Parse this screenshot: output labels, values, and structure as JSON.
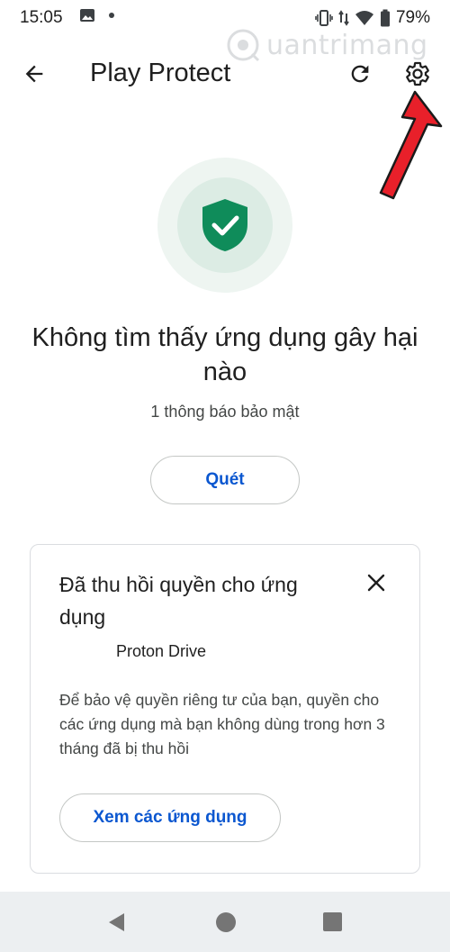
{
  "status_bar": {
    "time": "15:05",
    "battery": "79%",
    "icons": [
      "image-icon",
      "dot-icon",
      "vibrate-icon",
      "data-icon",
      "wifi-icon",
      "battery-icon"
    ]
  },
  "app_bar": {
    "title": "Play Protect",
    "back_icon": "arrow-back-icon",
    "refresh_icon": "refresh-icon",
    "settings_icon": "gear-icon"
  },
  "watermark": {
    "text": "uantrimang"
  },
  "status": {
    "headline": "Không tìm thấy ứng dụng gây hại nào",
    "subline": "1 thông báo bảo mật",
    "shield_icon": "shield-check-icon"
  },
  "scan_button": {
    "label": "Quét"
  },
  "card": {
    "title": "Đã thu hồi quyền cho ứng dụng",
    "app_name": "Proton Drive",
    "body": "Để bảo vệ quyền riêng tư của bạn, quyền cho các ứng dụng mà bạn không dùng trong hơn 3 tháng đã bị thu hồi",
    "button_label": "Xem các ứng dụng",
    "close_icon": "close-icon"
  },
  "colors": {
    "accent_blue": "#0b57d0",
    "shield_green": "#0f8c5a",
    "annotation_red": "#e8202a"
  }
}
